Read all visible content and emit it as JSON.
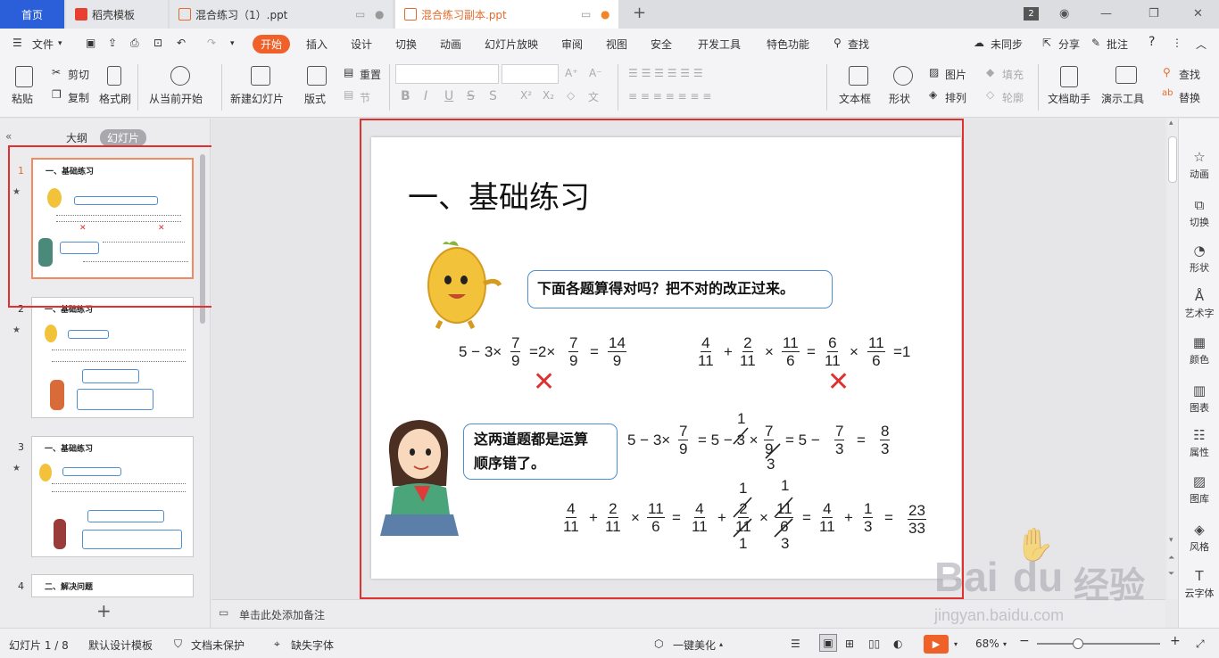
{
  "tabs": {
    "home": "首页",
    "templates": "稻壳模板",
    "file1": "混合练习（1）.ppt",
    "file2": "混合练习副本.ppt",
    "badge": "2"
  },
  "menu": {
    "file": "文件",
    "start": "开始",
    "items": [
      "插入",
      "设计",
      "切换",
      "动画",
      "幻灯片放映",
      "审阅",
      "视图",
      "安全",
      "开发工具",
      "特色功能"
    ],
    "search": "查找",
    "sync": "未同步",
    "share": "分享",
    "comment": "批注",
    "help": "?"
  },
  "ribbon": {
    "paste": "粘贴",
    "cut": "剪切",
    "copy": "复制",
    "format_painter": "格式刷",
    "from_start": "从当前开始",
    "new_slide": "新建幻灯片",
    "layout": "版式",
    "reset": "重置",
    "section": "节",
    "textbox": "文本框",
    "shape": "形状",
    "picture": "图片",
    "arrange": "排列",
    "fill": "填充",
    "outline": "轮廓",
    "doc_helper": "文档助手",
    "presenter": "演示工具",
    "find": "查找",
    "replace": "替换"
  },
  "panel": {
    "outline": "大纲",
    "slides": "幻灯片",
    "nums": [
      "1",
      "2",
      "3",
      "4"
    ],
    "titles": [
      "一、基础练习",
      "一、基础练习",
      "一、基础练习",
      "二、解决问题"
    ]
  },
  "slide": {
    "title": "一、基础练习",
    "bubble1": "下面各题算得对吗？把不对的改正过来。",
    "bubble2_l1": "这两道题都是运算",
    "bubble2_l2": "顺序错了。"
  },
  "notes": {
    "placeholder": "单击此处添加备注"
  },
  "status": {
    "slide_info": "幻灯片 1 / 8",
    "design": "默认设计模板",
    "protect": "文档未保护",
    "font": "缺失字体",
    "beautify": "一键美化",
    "zoom": "68%"
  },
  "right_panel": [
    "动画",
    "切换",
    "形状",
    "艺术字",
    "颜色",
    "图表",
    "属性",
    "图库",
    "风格",
    "云字体"
  ],
  "watermark": {
    "brand": "Bai",
    "brand2": "du",
    "jy": "经验",
    "url": "jingyan.baidu.com"
  },
  "colors": {
    "accent": "#f0612a",
    "blue": "#2b5fd9",
    "highlight": "#e03030"
  }
}
